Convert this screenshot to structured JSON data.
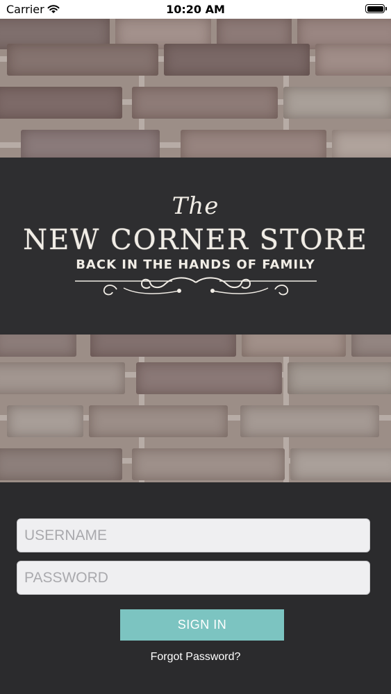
{
  "status_bar": {
    "carrier": "Carrier",
    "time": "10:20 AM",
    "wifi_icon": "wifi-icon",
    "battery_icon": "battery-icon"
  },
  "logo": {
    "the": "The",
    "name": "NEW CORNER STORE",
    "tagline": "BACK IN THE HANDS OF FAMILY"
  },
  "login": {
    "username_placeholder": "USERNAME",
    "username_value": "",
    "password_placeholder": "PASSWORD",
    "password_value": "",
    "signin_label": "SIGN IN",
    "forgot_label": "Forgot Password?"
  },
  "colors": {
    "background": "#2b2b2d",
    "accent": "#7cc4c1",
    "field_bg": "#efeff1"
  }
}
